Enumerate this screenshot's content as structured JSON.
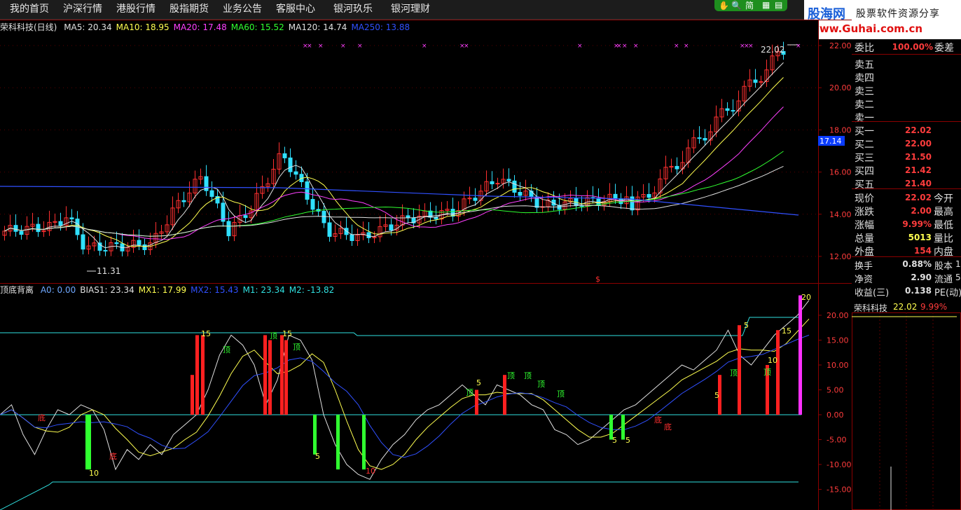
{
  "menu": {
    "items": [
      "我的首页",
      "沪深行情",
      "港股行情",
      "股指期货",
      "业务公告",
      "客服中心",
      "银河玖乐",
      "银河理财"
    ],
    "tools_label": "简"
  },
  "logo": {
    "name": "股海网",
    "slogan": "股票软件资源分享",
    "url": "www.Guhai.com.cn"
  },
  "main": {
    "title": "荣科科技(日线)",
    "ma": [
      {
        "label": "MA5: 20.34",
        "color": "#e0e0e0"
      },
      {
        "label": "MA10: 18.95",
        "color": "#ffff50"
      },
      {
        "label": "MA20: 17.48",
        "color": "#ff40ff"
      },
      {
        "label": "MA60: 15.52",
        "color": "#30ff30"
      },
      {
        "label": "MA120: 14.74",
        "color": "#e0e0e0"
      },
      {
        "label": "MA250: 13.88",
        "color": "#3050ff"
      }
    ],
    "y_ticks": [
      "22.00",
      "20.00",
      "18.00",
      "16.00",
      "14.00",
      "12.00"
    ],
    "price_tag": "17.14",
    "high_mark": "22.02",
    "low_mark": "11.31",
    "marker": "$"
  },
  "indicator": {
    "title": "顶底背离",
    "values": [
      {
        "label": "A0: 0.00",
        "color": "#6fa8ff"
      },
      {
        "label": "BIAS1: 23.34",
        "color": "#e0e0e0"
      },
      {
        "label": "MX1: 17.99",
        "color": "#ffff50"
      },
      {
        "label": "MX2: 15.43",
        "color": "#3050ff"
      },
      {
        "label": "M1: 23.34",
        "color": "#30e0e0"
      },
      {
        "label": "M2: -13.82",
        "color": "#30e0e0"
      }
    ],
    "y_ticks": [
      "20.00",
      "15.00",
      "10.00",
      "5.00",
      "0.00",
      "-5.00",
      "-10.00",
      "-15.00"
    ],
    "top_label": "顶",
    "bottom_label": "底",
    "sample_5": "5",
    "sample_10": "10",
    "sample_15": "15",
    "right_edge": "20"
  },
  "panel": {
    "ratio": {
      "label": "委比",
      "value": "100.00%",
      "label2": "委差"
    },
    "asks": [
      "卖五",
      "卖四",
      "卖三",
      "卖二",
      "卖一"
    ],
    "bids": [
      {
        "label": "买一",
        "price": "22.02"
      },
      {
        "label": "买二",
        "price": "22.00"
      },
      {
        "label": "买三",
        "price": "21.50"
      },
      {
        "label": "买四",
        "price": "21.42"
      },
      {
        "label": "买五",
        "price": "21.40"
      }
    ],
    "stats": [
      {
        "label": "现价",
        "value": "22.02",
        "color": "#ff3c3c",
        "label2": "今开"
      },
      {
        "label": "涨跌",
        "value": "2.00",
        "color": "#ff3c3c",
        "label2": "最高"
      },
      {
        "label": "涨幅",
        "value": "9.99%",
        "color": "#ff3c3c",
        "label2": "最低"
      },
      {
        "label": "总量",
        "value": "5013",
        "color": "#ffff50",
        "label2": "量比"
      },
      {
        "label": "外盘",
        "value": "154",
        "color": "#ff3c3c",
        "label2": "内盘"
      }
    ],
    "stats2": [
      {
        "label": "换手",
        "value": "0.88%",
        "label2": "股本"
      },
      {
        "label": "净资",
        "value": "2.90",
        "label2": "流通"
      },
      {
        "label": "收益(三)",
        "value": "0.138",
        "label2": "PE(动)"
      }
    ],
    "stats2_right": [
      "1",
      "5"
    ],
    "mini": {
      "name": "荣科科技",
      "price": "22.02",
      "pct": "9.99%"
    }
  },
  "colors": {
    "up": "#ff3030",
    "down": "#30e0ff",
    "axis": "#8b0000",
    "bar_green": "#30ff30",
    "bar_red": "#ff2020",
    "bar_magenta": "#ff30ff"
  }
}
